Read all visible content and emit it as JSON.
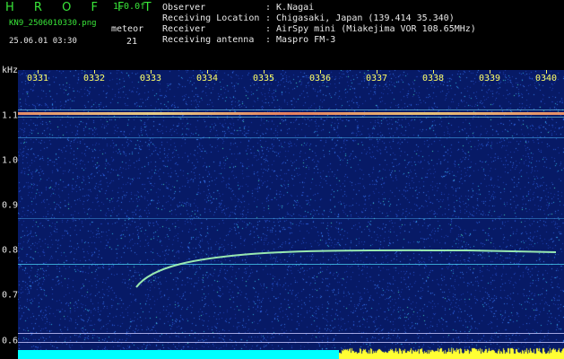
{
  "header": {
    "logo_text": "H R O F F T",
    "version": "1.0.0f",
    "filename": "KN9_2506010330.png",
    "meteor_label": "meteor",
    "meteor_count": "21",
    "datetime": "25.06.01 03:30"
  },
  "info": [
    {
      "key": "Observer",
      "value": ": K.Nagai"
    },
    {
      "key": "Receiving Location",
      "value": ": Chigasaki, Japan (139.414 35.340)"
    },
    {
      "key": "Receiver",
      "value": ": AirSpy mini (Miakejima VOR 108.65MHz)"
    },
    {
      "key": "Receiving antenna",
      "value": ": Maspro FM-3"
    }
  ],
  "spectrogram": {
    "y_unit": "kHz",
    "y_ticks": [
      "1.1",
      "1.0",
      "0.9",
      "0.8",
      "0.7",
      "0.6"
    ],
    "y_values": [
      1.1,
      1.0,
      0.9,
      0.8,
      0.7,
      0.6
    ],
    "x_ticks": [
      "0331",
      "0332",
      "0333",
      "0334",
      "0335",
      "0336",
      "0337",
      "0338",
      "0339",
      "0340"
    ],
    "colors": {
      "background": "#071a66",
      "carrier": "#ff9966",
      "meteor_trace": "#a8ffb8",
      "axis_labels": "#ffff66",
      "bottom_bar_left": "#00ffff",
      "bottom_bar_right": "#ffff33"
    }
  }
}
